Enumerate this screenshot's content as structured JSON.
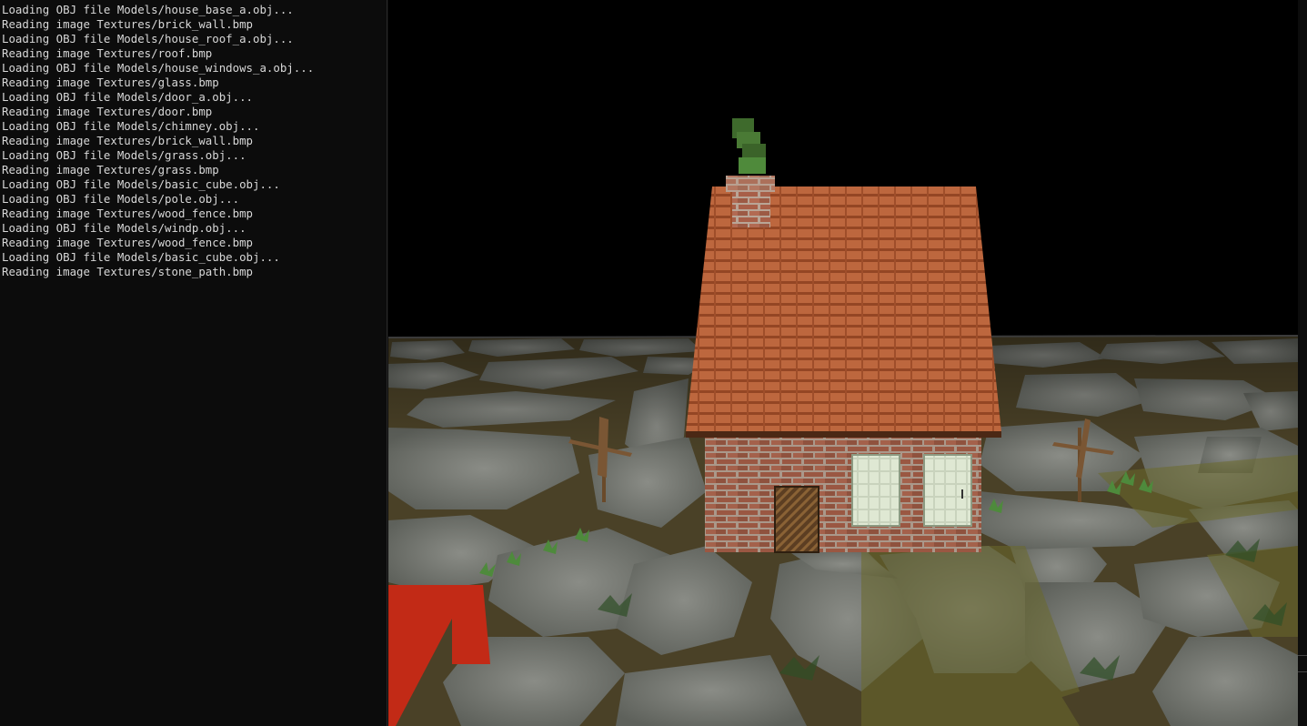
{
  "console": {
    "lines": [
      "Loading OBJ file Models/house_base_a.obj...",
      "Reading image Textures/brick_wall.bmp",
      "Loading OBJ file Models/house_roof_a.obj...",
      "Reading image Textures/roof.bmp",
      "Loading OBJ file Models/house_windows_a.obj...",
      "Reading image Textures/glass.bmp",
      "Loading OBJ file Models/door_a.obj...",
      "Reading image Textures/door.bmp",
      "Loading OBJ file Models/chimney.obj...",
      "Reading image Textures/brick_wall.bmp",
      "Loading OBJ file Models/grass.obj...",
      "Reading image Textures/grass.bmp",
      "Loading OBJ file Models/basic_cube.obj...",
      "Loading OBJ file Models/pole.obj...",
      "Reading image Textures/wood_fence.bmp",
      "Loading OBJ file Models/windp.obj...",
      "Reading image Textures/wood_fence.bmp",
      "Loading OBJ file Models/basic_cube.obj...",
      "Reading image Textures/stone_path.bmp"
    ]
  },
  "colors": {
    "console_bg": "#0c0c0c",
    "console_text": "#d8d8d8",
    "sky": "#000000",
    "stone": "#6f726b",
    "moss": "#5a5a2a",
    "roof": "#c2653c",
    "brick": "#a8664e",
    "window": "#d6e0c8",
    "door": "#6b4a2a",
    "red_cube": "#c22a16",
    "smoke": "#3f6a2e"
  }
}
